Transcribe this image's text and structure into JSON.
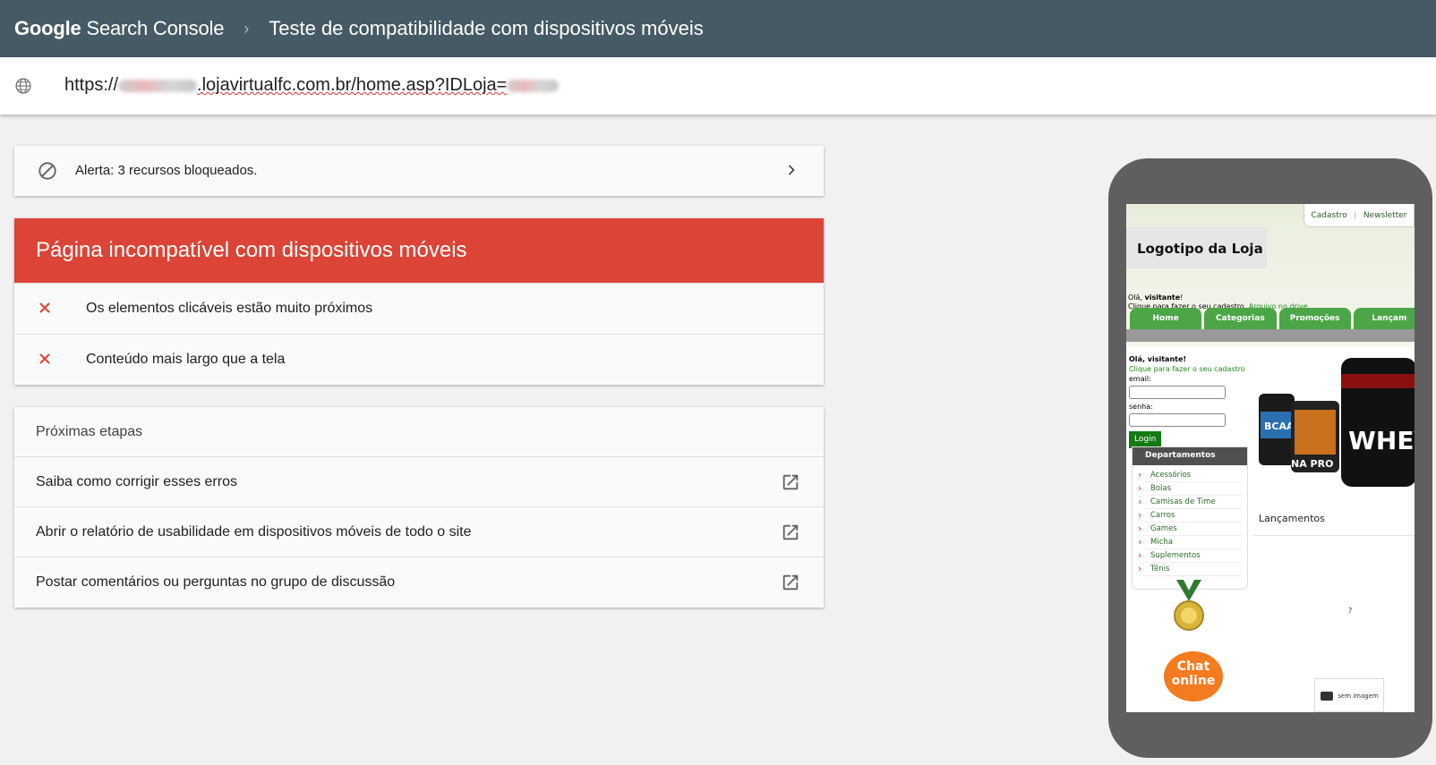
{
  "header": {
    "brand_google": "Google",
    "brand_product": "Search Console",
    "separator": "›",
    "title": "Teste de compatibilidade com dispositivos móveis"
  },
  "urlbar": {
    "url_prefix": "https://",
    "url_domain": ".lojavirtualfc.com.br/home.asp?IDLoja="
  },
  "alert": {
    "text": "Alerta: 3 recursos bloqueados."
  },
  "result": {
    "title": "Página incompatível com dispositivos móveis",
    "issues": [
      {
        "text": "Os elementos clicáveis estão muito próximos"
      },
      {
        "text": "Conteúdo mais largo que a tela"
      }
    ]
  },
  "next_steps": {
    "title": "Próximas etapas",
    "items": [
      {
        "text": "Saiba como corrigir esses erros"
      },
      {
        "text": "Abrir o relatório de usabilidade em dispositivos móveis de todo o site"
      },
      {
        "text": "Postar comentários ou perguntas no grupo de discussão"
      }
    ]
  },
  "preview": {
    "top_links": [
      "Cadastro",
      "Newsletter"
    ],
    "logo": "Logotipo da Loja",
    "hello_prefix": "Olá, ",
    "hello_user": "visitante",
    "hello_suffix": "!",
    "register_text": "Clique para fazer o seu cadastro.",
    "drive_link": "Arquivo no drive",
    "nav_tabs": [
      "Home",
      "Categorias",
      "Promoções",
      "Lançam"
    ],
    "login_hello": "Olá, visitante!",
    "login_register": "Clique para fazer o seu cadastro",
    "email_label": "email:",
    "senha_label": "senha:",
    "login_button": "Login",
    "departments_title": "Departamentos",
    "departments": [
      "Acessórios",
      "Bolas",
      "Camisas de Time",
      "Carros",
      "Games",
      "Micha",
      "Suplementos",
      "Tênis"
    ],
    "launches": "Lançamentos",
    "chat_line1": "Chat",
    "chat_line2": "online",
    "question_mark": "?",
    "no_image": "sem imagem",
    "product_labels": [
      "BCAA",
      "NA PRO",
      "WHEY"
    ]
  },
  "colors": {
    "header_bg": "#455a64",
    "error_red": "#db4437",
    "x_red": "#db4437",
    "card_bg": "#fafafa",
    "page_bg": "#f1f1f1",
    "phone_frame": "#5f5f5f",
    "store_green": "#4ca647"
  },
  "icons": {
    "globe": "globe-icon",
    "blocked": "blocked-icon",
    "chevron": "chevron-right-icon",
    "close": "close-icon",
    "open_in_new": "open-in-new-icon"
  }
}
